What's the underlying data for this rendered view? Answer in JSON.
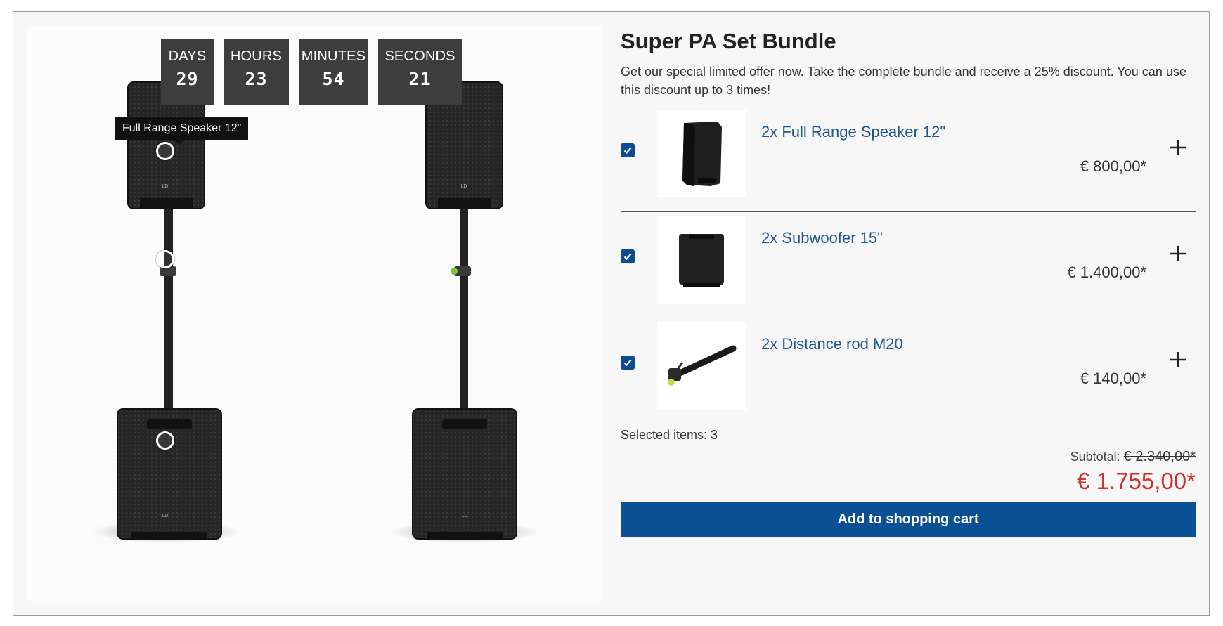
{
  "countdown": [
    {
      "label": "DAYS",
      "value": "29"
    },
    {
      "label": "HOURS",
      "value": "23"
    },
    {
      "label": "MINUTES",
      "value": "54"
    },
    {
      "label": "SECONDS",
      "value": "21"
    }
  ],
  "tooltip": "Full Range Speaker 12\"",
  "bundle": {
    "title": "Super PA Set Bundle",
    "description": "Get our special limited offer now. Take the complete bundle and receive a 25% discount. You can use this discount up to 3 times!",
    "items": [
      {
        "name": "2x Full Range Speaker 12\"",
        "price": "€ 800,00*",
        "checked": true,
        "icon": "speaker-thumbnail"
      },
      {
        "name": "2x Subwoofer 15\"",
        "price": "€ 1.400,00*",
        "checked": true,
        "icon": "subwoofer-thumbnail"
      },
      {
        "name": "2x Distance rod M20",
        "price": "€ 140,00*",
        "checked": true,
        "icon": "distance-rod-thumbnail"
      }
    ],
    "selected_label": "Selected items: 3",
    "subtotal_label": "Subtotal:",
    "subtotal_old": "€ 2.340,00*",
    "total": "€ 1.755,00*",
    "cart_button": "Add to shopping cart"
  },
  "colors": {
    "accent": "#0b4f95",
    "price_highlight": "#d0302a",
    "link": "#1d5690"
  }
}
